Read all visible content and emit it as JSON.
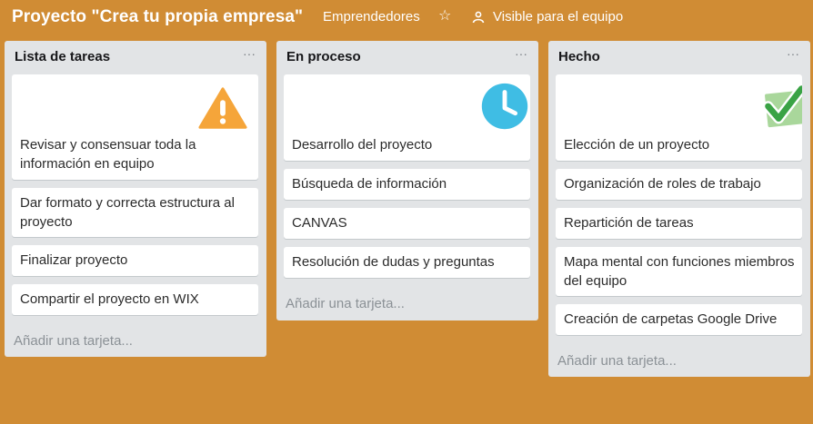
{
  "board": {
    "title": "Proyecto \"Crea tu propia empresa\"",
    "team": "Emprendedores",
    "star_icon": "star-icon",
    "visibility": "Visible para el equipo"
  },
  "lists": [
    {
      "title": "Lista de tareas",
      "menu": "···",
      "sticker": "warning-icon",
      "cards": [
        "Revisar y consensuar toda la información en equipo",
        "Dar formato y correcta estructura al proyecto",
        "Finalizar proyecto",
        "Compartir el proyecto en WIX"
      ],
      "add_card": "Añadir una tarjeta..."
    },
    {
      "title": "En proceso",
      "menu": "···",
      "sticker": "clock-icon",
      "cards": [
        "Desarrollo del proyecto",
        "Búsqueda de información",
        "CANVAS",
        "Resolución de dudas y preguntas"
      ],
      "add_card": "Añadir una tarjeta..."
    },
    {
      "title": "Hecho",
      "menu": "···",
      "sticker": "check-icon",
      "cards": [
        "Elección de un proyecto",
        "Organización de roles de trabajo",
        "Repartición de tareas",
        "Mapa mental con funciones miembros del equipo",
        "Creación de carpetas Google Drive"
      ],
      "add_card": "Añadir una tarjeta..."
    }
  ],
  "colors": {
    "board_background": "#d08c34",
    "list_background": "#e2e4e6",
    "card_background": "#ffffff",
    "warning": "#f5a53a",
    "clock": "#3fbde4",
    "check": "#3aa345"
  }
}
